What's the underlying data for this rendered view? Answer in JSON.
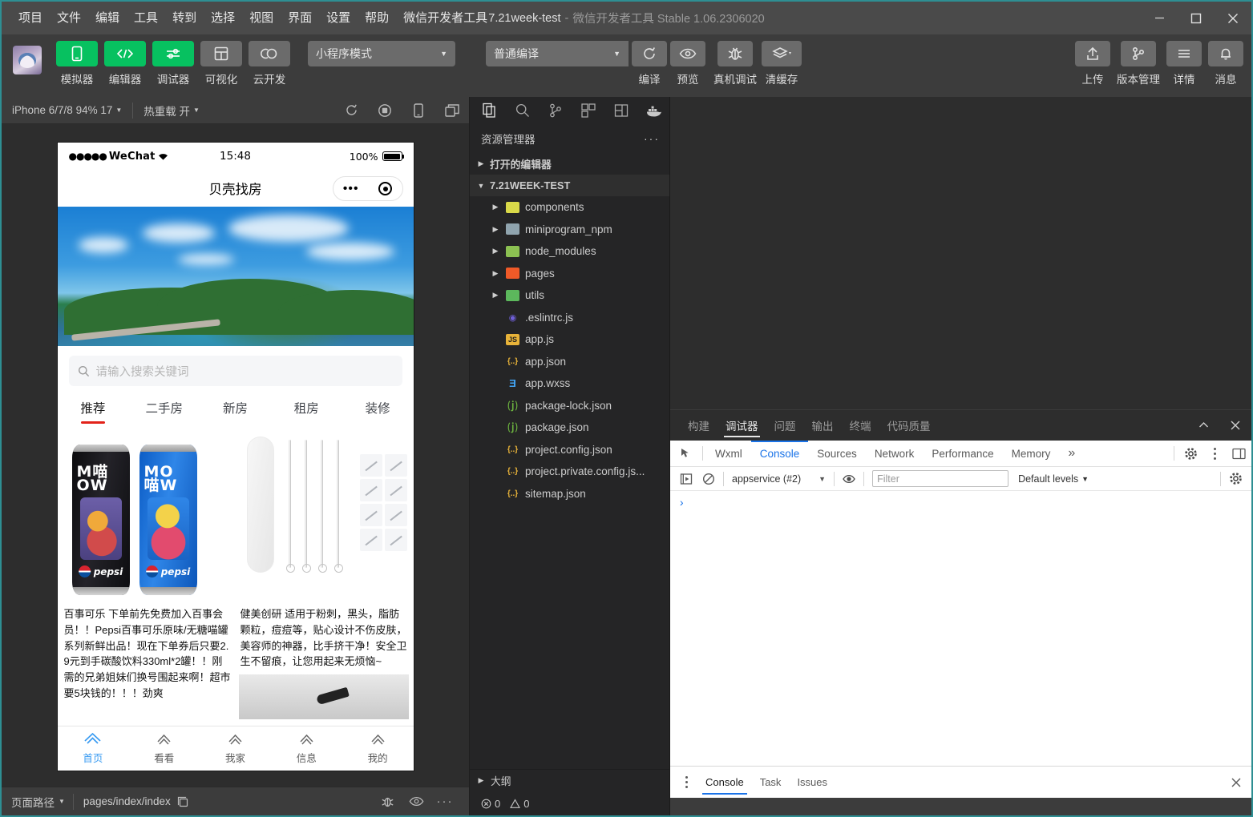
{
  "window": {
    "menus": [
      "项目",
      "文件",
      "编辑",
      "工具",
      "转到",
      "选择",
      "视图",
      "界面",
      "设置",
      "帮助",
      "微信开发者工具"
    ],
    "project_name": "7.21week-test",
    "title_sep": "-",
    "app_version": "微信开发者工具 Stable 1.06.2306020",
    "controls": {
      "minimize": "minimize-icon",
      "maximize": "maximize-icon",
      "close": "close-icon"
    }
  },
  "toolbar": {
    "avatar": "user-avatar",
    "left_buttons": [
      {
        "label": "模拟器",
        "icon": "phone-icon",
        "active": true
      },
      {
        "label": "编辑器",
        "icon": "code-icon",
        "active": true
      },
      {
        "label": "调试器",
        "icon": "debugger-icon",
        "active": true
      },
      {
        "label": "可视化",
        "icon": "layout-icon",
        "active": false
      },
      {
        "label": "云开发",
        "icon": "cloud-icon",
        "active": false
      }
    ],
    "mode_select": "小程序模式",
    "compile_select": "普通编译",
    "center_buttons": [
      {
        "label": "编译",
        "icon": "refresh-icon"
      },
      {
        "label": "预览",
        "icon": "eye-icon"
      },
      {
        "label": "真机调试",
        "icon": "bug-icon"
      },
      {
        "label": "清缓存",
        "icon": "layers-icon"
      }
    ],
    "right_buttons": [
      {
        "label": "上传",
        "icon": "upload-icon"
      },
      {
        "label": "版本管理",
        "icon": "git-branch-icon"
      },
      {
        "label": "详情",
        "icon": "menu-icon"
      },
      {
        "label": "消息",
        "icon": "bell-icon"
      }
    ]
  },
  "simulator": {
    "device": "iPhone 6/7/8 94% 17",
    "hot_reload": "热重载 开",
    "icons": [
      "refresh-icon",
      "record-icon",
      "device-icon",
      "windows-icon"
    ],
    "phone": {
      "status": {
        "carrier": "WeChat",
        "signal_dots": "●●●●●",
        "wifi": "wifi-icon",
        "time": "15:48",
        "battery_pct": "100%"
      },
      "nav_title": "贝壳找房",
      "capsule": {
        "menu": "more-dots-icon",
        "target": "target-icon"
      },
      "banner": "scenery-banner-image",
      "search_placeholder": "请输入搜索关键词",
      "tabs": [
        {
          "label": "推荐",
          "active": true
        },
        {
          "label": "二手房",
          "active": false
        },
        {
          "label": "新房",
          "active": false
        },
        {
          "label": "租房",
          "active": false
        },
        {
          "label": "装修",
          "active": false
        }
      ],
      "cards": [
        {
          "image": "pepsi-meow-cans-image",
          "desc": "百事可乐 下单前先免费加入百事会员！！Pepsi百事可乐原味/无糖喵罐系列新鲜出品！现在下单券后只要2.9元到手碳酸饮料330ml*2罐！！刚需的兄弟姐妹们换号围起来啊！超市要5块钱的！！！劲爽"
        },
        {
          "image": "blackhead-needle-tools-image",
          "desc": "健美创研 适用于粉刺，黑头，脂肪颗粒，痘痘等，贴心设计不伤皮肤，美容师的神器，比手挤干净！安全卫生不留痕，让您用起来无烦恼~"
        }
      ],
      "tabbar": [
        {
          "label": "首页",
          "active": true
        },
        {
          "label": "看看",
          "active": false
        },
        {
          "label": "我家",
          "active": false
        },
        {
          "label": "信息",
          "active": false
        },
        {
          "label": "我的",
          "active": false
        }
      ]
    },
    "statusbar": {
      "page_path_label": "页面路径",
      "page_path": "pages/index/index",
      "copy_icon": "copy-icon",
      "icons": [
        "bug-icon",
        "eye-icon",
        "more-icon"
      ]
    }
  },
  "explorer": {
    "activity_icons": [
      "files-icon",
      "search-icon",
      "source-control-icon",
      "extensions-icon",
      "split-icon",
      "docker-icon"
    ],
    "title": "资源管理器",
    "more": "···",
    "sections": [
      {
        "label": "打开的编辑器",
        "expanded": false
      },
      {
        "label": "7.21WEEK-TEST",
        "expanded": true
      }
    ],
    "folders": [
      {
        "name": "components",
        "icon_color": "#d9d949"
      },
      {
        "name": "miniprogram_npm",
        "icon_color": "#90a4ae"
      },
      {
        "name": "node_modules",
        "icon_color": "#8cc152"
      },
      {
        "name": "pages",
        "icon_color": "#f05a28"
      },
      {
        "name": "utils",
        "icon_color": "#5cb85c"
      }
    ],
    "files": [
      {
        "name": ".eslintrc.js",
        "icon": "eslint-icon",
        "color": "#4b32c3",
        "glyph": "◉"
      },
      {
        "name": "app.js",
        "icon": "js-icon",
        "color": "#e8b339",
        "glyph": "JS"
      },
      {
        "name": "app.json",
        "icon": "json-icon",
        "color": "#e8b339",
        "glyph": "{..}"
      },
      {
        "name": "app.wxss",
        "icon": "css-icon",
        "color": "#42a5f5",
        "glyph": "Ǝ"
      },
      {
        "name": "package-lock.json",
        "icon": "npm-icon",
        "color": "#6cb33f",
        "glyph": "⒥"
      },
      {
        "name": "package.json",
        "icon": "npm-icon",
        "color": "#6cb33f",
        "glyph": "⒥"
      },
      {
        "name": "project.config.json",
        "icon": "json-icon",
        "color": "#e8b339",
        "glyph": "{..}"
      },
      {
        "name": "project.private.config.js...",
        "icon": "json-icon",
        "color": "#e8b339",
        "glyph": "{..}"
      },
      {
        "name": "sitemap.json",
        "icon": "json-icon",
        "color": "#e8b339",
        "glyph": "{..}"
      }
    ],
    "outline": "大纲",
    "problems": {
      "errors": "0",
      "warnings": "0"
    }
  },
  "devtools": {
    "panel_tabs": [
      {
        "label": "构建",
        "active": false
      },
      {
        "label": "调试器",
        "active": true
      },
      {
        "label": "问题",
        "active": false
      },
      {
        "label": "输出",
        "active": false
      },
      {
        "label": "终端",
        "active": false
      },
      {
        "label": "代码质量",
        "active": false
      }
    ],
    "panel_actions": [
      "collapse-icon",
      "close-icon"
    ],
    "inspector_tabs": [
      {
        "label": "Wxml",
        "active": false
      },
      {
        "label": "Console",
        "active": true
      },
      {
        "label": "Sources",
        "active": false
      },
      {
        "label": "Network",
        "active": false
      },
      {
        "label": "Performance",
        "active": false
      },
      {
        "label": "Memory",
        "active": false
      }
    ],
    "more_tabs": "»",
    "inspector_right_icons": [
      "settings-gear-icon",
      "kebab-menu-icon",
      "dock-icon"
    ],
    "console": {
      "execute_icon": "execute-icon",
      "clear_icon": "clear-console-icon",
      "context": "appservice (#2)",
      "eye_icon": "live-expression-icon",
      "filter_placeholder": "Filter",
      "levels": "Default levels",
      "settings_icon": "settings-gear-icon",
      "prompt": "›"
    },
    "drawer_tabs": [
      {
        "label": "Console",
        "active": true
      },
      {
        "label": "Task",
        "active": false
      },
      {
        "label": "Issues",
        "active": false
      }
    ],
    "drawer_close": "close-icon"
  },
  "colors": {
    "accent_green": "#07c160",
    "accent_blue": "#1a73e8",
    "titlebar_bg": "#4a4a4a",
    "toolbar_bg": "#3c3c3c",
    "explorer_bg": "#252526",
    "tab_underline_red": "#e2231a"
  }
}
